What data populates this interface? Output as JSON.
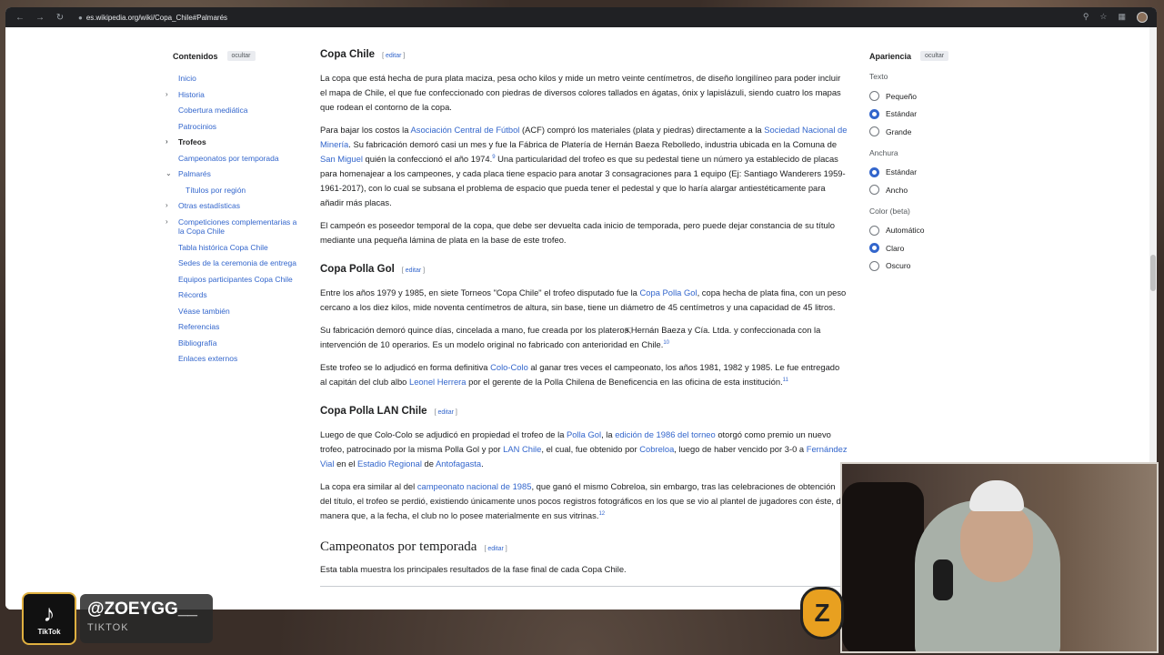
{
  "browser": {
    "url": "es.wikipedia.org/wiki/Copa_Chile#Palmarés"
  },
  "toc": {
    "title": "Contenidos",
    "hide": "ocultar",
    "items": [
      {
        "label": "Inicio"
      },
      {
        "label": "Historia"
      },
      {
        "label": "Cobertura mediática"
      },
      {
        "label": "Patrocinios"
      },
      {
        "label": "Trofeos"
      },
      {
        "label": "Campeonatos por temporada"
      },
      {
        "label": "Palmarés"
      },
      {
        "label": "Títulos por región"
      },
      {
        "label": "Otras estadísticas"
      },
      {
        "label": "Competiciones complementarias a la Copa Chile"
      },
      {
        "label": "Tabla histórica Copa Chile"
      },
      {
        "label": "Sedes de la ceremonia de entrega"
      },
      {
        "label": "Equipos participantes Copa Chile"
      },
      {
        "label": "Récords"
      },
      {
        "label": "Véase también"
      },
      {
        "label": "Referencias"
      },
      {
        "label": "Bibliografía"
      },
      {
        "label": "Enlaces externos"
      }
    ]
  },
  "edit_label": "editar",
  "sections": {
    "copa_chile": {
      "title": "Copa Chile",
      "p1": "La copa que está hecha de pura plata maciza, pesa ocho kilos y mide un metro veinte centímetros, de diseño longilíneo para poder incluir el mapa de Chile, el que fue confeccionado con piedras de diversos colores tallados en ágatas, ónix y lapislázuli, siendo cuatro los mapas que rodean el contorno de la copa.",
      "p2a": "Para bajar los costos la ",
      "p2_link1": "Asociación Central de Fútbol",
      "p2b": " (ACF) compró los materiales (plata y piedras) directamente a la ",
      "p2_link2": "Sociedad Nacional de Minería",
      "p2c": ". Su fabricación demoró casi un mes y fue la Fábrica de Platería de Hernán Baeza Rebolledo, industria ubicada en la Comuna de ",
      "p2_link3": "San Miguel",
      "p2d": " quién la confeccionó el año 1974.",
      "p2_ref": "9",
      "p2e": " Una particularidad del trofeo es que su pedestal tiene un número ya establecido de placas para homenajear a los campeones, y cada placa tiene espacio para anotar 3 consagraciones para 1 equipo (Ej: Santiago Wanderers 1959-1961-2017), con lo cual se subsana el problema de espacio que pueda tener el pedestal y que lo haría alargar antiestéticamente para añadir más placas.",
      "p3": "El campeón es poseedor temporal de la copa, que debe ser devuelta cada inicio de temporada, pero puede dejar constancia de su título mediante una pequeña lámina de plata en la base de este trofeo."
    },
    "polla_gol": {
      "title": "Copa Polla Gol",
      "p1a": "Entre los años 1979 y 1985, en siete Torneos \"Copa Chile\" el trofeo disputado fue la ",
      "p1_link": "Copa Polla Gol",
      "p1b": ", copa hecha de plata fina, con un peso cercano a los diez kilos, mide noventa centímetros de altura, sin base, tiene un diámetro de 45 centímetros y una capacidad de 45 litros.",
      "p2": "Su fabricación demoró quince días, cincelada a mano, fue creada por los plateros Hernán Baeza y Cía. Ltda. y confeccionada con la intervención de 10 operarios. Es un modelo original no fabricado con anterioridad en Chile.",
      "p2_ref": "10",
      "p3a": "Este trofeo se lo adjudicó en forma definitiva ",
      "p3_link1": "Colo-Colo",
      "p3b": " al ganar tres veces el campeonato, los años 1981, 1982 y 1985. Le fue entregado al capitán del club albo ",
      "p3_link2": "Leonel Herrera",
      "p3c": " por el gerente de la Polla Chilena de Beneficencia en las oficina de esta institución.",
      "p3_ref": "11"
    },
    "lan_chile": {
      "title": "Copa Polla LAN Chile",
      "p1a": "Luego de que Colo-Colo se adjudicó en propiedad el trofeo de la ",
      "p1_link1": "Polla Gol",
      "p1b": ", la ",
      "p1_link2": "edición de 1986 del torneo",
      "p1c": " otorgó como premio un nuevo trofeo, patrocinado por la misma Polla Gol y por ",
      "p1_link3": "LAN Chile",
      "p1d": ", el cual, fue obtenido por ",
      "p1_link4": "Cobreloa",
      "p1e": ", luego de haber vencido por 3-0 a ",
      "p1_link5": "Fernández Vial",
      "p1f": " en el ",
      "p1_link6": "Estadio Regional",
      "p1g": " de ",
      "p1_link7": "Antofagasta",
      "p1h": ".",
      "p2a": "La copa era similar al del ",
      "p2_link": "campeonato nacional de 1985",
      "p2b": ", que ganó el mismo Cobreloa, sin embargo, tras las celebraciones de obtención del título, el trofeo se perdió, existiendo únicamente unos pocos registros fotográficos en los que se vio al plantel de jugadores con éste, de manera que, a la fecha, el club no lo posee materialmente en sus vitrinas.",
      "p2_ref": "12"
    },
    "temporada": {
      "title": "Campeonatos por temporada",
      "p1": "Esta tabla muestra los principales resultados de la fase final de cada Copa Chile."
    }
  },
  "appearance": {
    "title": "Apariencia",
    "hide": "ocultar",
    "text_label": "Texto",
    "text_options": [
      {
        "label": "Pequeño",
        "on": false
      },
      {
        "label": "Estándar",
        "on": true
      },
      {
        "label": "Grande",
        "on": false
      }
    ],
    "width_label": "Anchura",
    "width_options": [
      {
        "label": "Estándar",
        "on": true
      },
      {
        "label": "Ancho",
        "on": false
      }
    ],
    "color_label": "Color (beta)",
    "color_options": [
      {
        "label": "Automático",
        "on": false
      },
      {
        "label": "Claro",
        "on": true
      },
      {
        "label": "Oscuro",
        "on": false
      }
    ]
  },
  "overlay": {
    "tiktok_word": "TikTok",
    "handle": "@ZOEYGG__",
    "platform": "TIKTOK",
    "badge_letter": "Z"
  },
  "colors": {
    "link": "#3366cc",
    "accent_radio": "#3366cc",
    "tiktok_border": "#e0b040"
  }
}
